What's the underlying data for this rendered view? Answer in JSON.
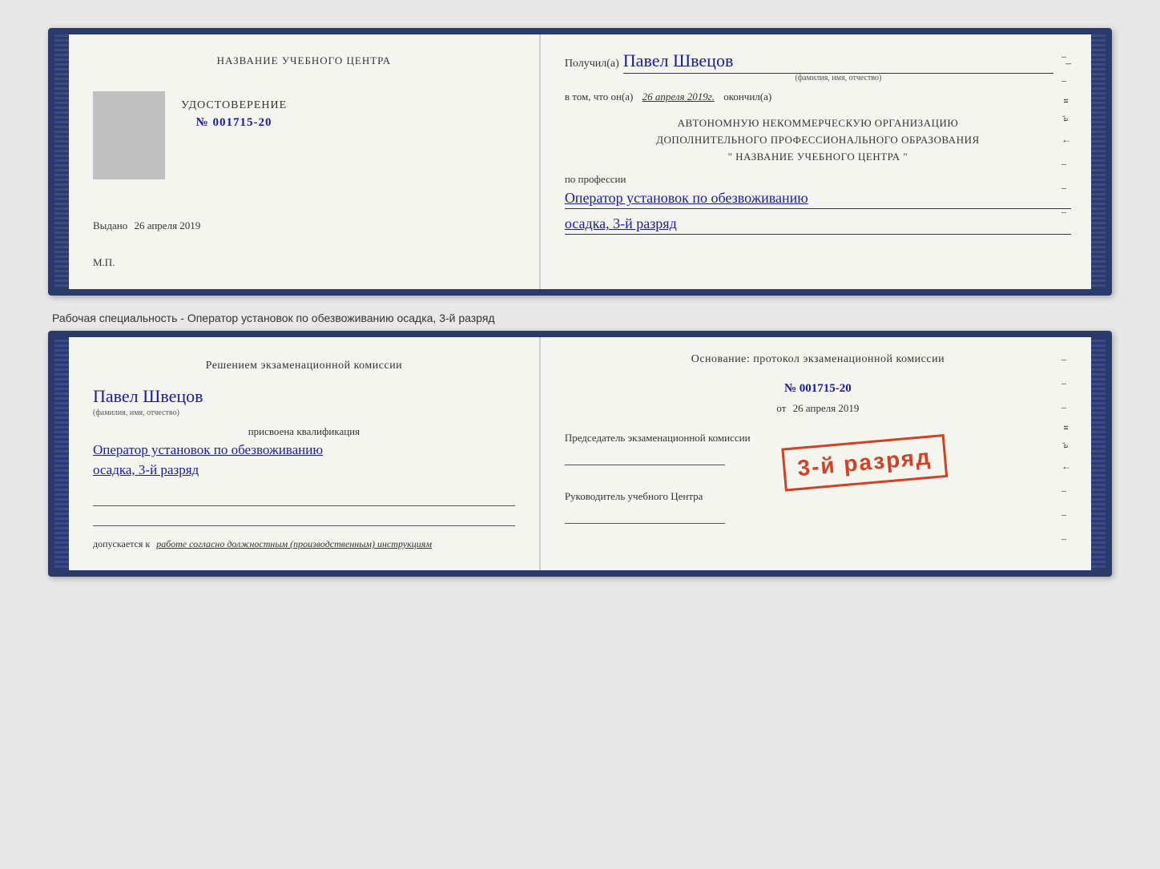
{
  "doc1": {
    "left": {
      "center_title": "НАЗВАНИЕ УЧЕБНОГО ЦЕНТРА",
      "cert_label": "УДОСТОВЕРЕНИЕ",
      "cert_number": "№ 001715-20",
      "issued_label": "Выдано",
      "issued_date": "26 апреля 2019",
      "mp_label": "М.П."
    },
    "right": {
      "received_label": "Получил(а)",
      "recipient_name": "Павел Швецов",
      "name_sub": "(фамилия, имя, отчество)",
      "in_that_label": "в том, что он(а)",
      "date_text": "26 апреля 2019г.",
      "completed_label": "окончил(а)",
      "org_line1": "АВТОНОМНУЮ НЕКОММЕРЧЕСКУЮ ОРГАНИЗАЦИЮ",
      "org_line2": "ДОПОЛНИТЕЛЬНОГО ПРОФЕССИОНАЛЬНОГО ОБРАЗОВАНИЯ",
      "org_line3": "\"  НАЗВАНИЕ УЧЕБНОГО ЦЕНТРА  \"",
      "profession_label": "по профессии",
      "profession_text": "Оператор установок по обезвоживанию",
      "rank_text": "осадка, 3-й разряд",
      "dash1": "–",
      "letter_i": "и",
      "letter_a": ",а",
      "arrow": "←"
    }
  },
  "between_text": "Рабочая специальность - Оператор установок по обезвоживанию осадка, 3-й разряд",
  "doc2": {
    "left": {
      "decision_title": "Решением  экзаменационной  комиссии",
      "person_name": "Павел Швецов",
      "name_sub": "(фамилия, имя, отчество)",
      "assigned_label": "присвоена квалификация",
      "qualification_text": "Оператор установок по обезвоживанию",
      "rank_text": "осадка, 3-й разряд",
      "allow_label": "допускается к",
      "allow_text": "работе согласно должностным (производственным) инструкциям"
    },
    "right": {
      "basis_label": "Основание: протокол экзаменационной  комиссии",
      "protocol_number": "№  001715-20",
      "from_label": "от",
      "from_date": "26 апреля 2019",
      "chairman_label": "Председатель экзаменационной комиссии",
      "stamp_text": "3-й разряд",
      "manager_label": "Руководитель учебного Центра",
      "dash1": "–",
      "dash2": "–",
      "dash3": "–",
      "letter_i": "и",
      "letter_a": ",а",
      "arrow": "←"
    }
  }
}
